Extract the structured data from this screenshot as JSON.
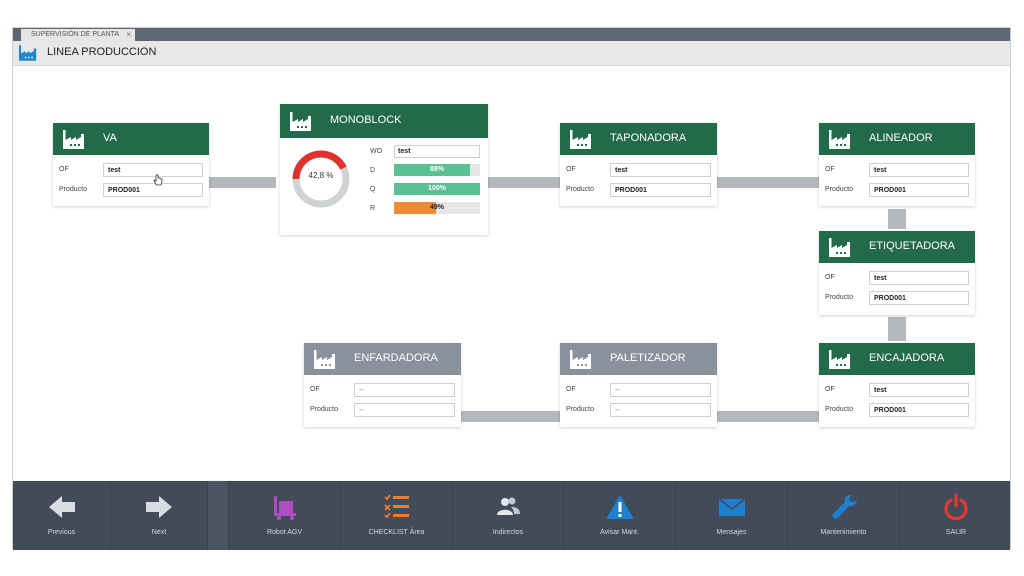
{
  "window": {
    "tab_label": "SUPERVISIÓN DE PLANTA",
    "tab_close": "×",
    "page_title": "LINEA PRODUCCION"
  },
  "labels": {
    "of": "OF",
    "producto": "Producto",
    "wo": "WO",
    "d": "D",
    "q": "Q",
    "r": "R"
  },
  "nodes": {
    "va": {
      "title": "VA",
      "of": "test",
      "producto": "PROD001"
    },
    "monoblock": {
      "title": "MONOBLOCK",
      "gauge": "42,8 %",
      "gauge_value": 42.8,
      "wo": "test",
      "d_text": "88%",
      "d_value": 88,
      "q_text": "100%",
      "q_value": 100,
      "r_text": "49%",
      "r_value": 49
    },
    "taponadora": {
      "title": "TAPONADORA",
      "of": "test",
      "producto": "PROD001"
    },
    "alineador": {
      "title": "ALINEADOR",
      "of": "test",
      "producto": "PROD001"
    },
    "etiquetadora": {
      "title": "ETIQUETADORA",
      "of": "test",
      "producto": "PROD001"
    },
    "encajadora": {
      "title": "ENCAJADORA",
      "of": "test",
      "producto": "PROD001"
    },
    "paletizador": {
      "title": "PALETIZADOR",
      "of": "--",
      "producto": "--"
    },
    "enfardadora": {
      "title": "ENFARDADORA",
      "of": "--",
      "producto": "--"
    }
  },
  "colors": {
    "header_active": "#236a4b",
    "header_inactive": "#8a919c",
    "bar_green": "#5cbf95",
    "bar_orange": "#ef8a34",
    "gauge_red": "#e0312c",
    "gauge_gray": "#cfd3d6",
    "toolbar_bg": "#414b59"
  },
  "toolbar": {
    "previous": "Previous",
    "next": "Next",
    "robot_agv": "Robot AGV",
    "checklist": "CHECKLIST Área",
    "indirectos": "Indirectos",
    "avisar": "Avisar Mant.",
    "mensajes": "Mensajes",
    "mantenimiento": "Mantenimiento",
    "salir": "SALIR"
  },
  "icons": {
    "node": "factory-icon",
    "previous": "arrow-left-icon",
    "next": "arrow-right-icon",
    "robot_agv": "robot-cart-icon",
    "checklist": "checklist-icon",
    "indirectos": "users-icon",
    "avisar": "warning-icon",
    "mensajes": "envelope-icon",
    "mantenimiento": "wrench-icon",
    "salir": "power-icon"
  }
}
